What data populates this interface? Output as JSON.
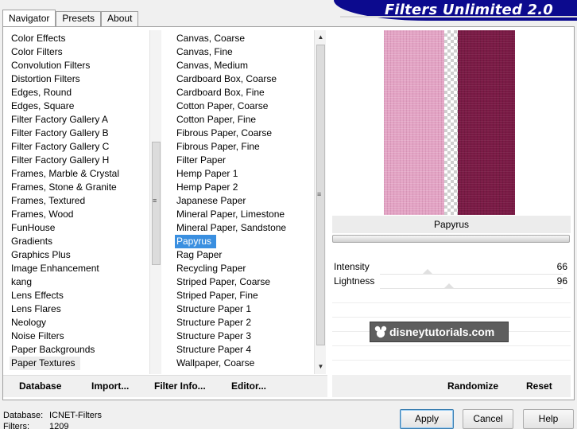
{
  "tabs": [
    {
      "label": "Navigator",
      "active": true
    },
    {
      "label": "Presets",
      "active": false
    },
    {
      "label": "About",
      "active": false
    }
  ],
  "title": "Filters Unlimited 2.0",
  "categories": {
    "items": [
      "Color Effects",
      "Color Filters",
      "Convolution Filters",
      "Distortion Filters",
      "Edges, Round",
      "Edges, Square",
      "Filter Factory Gallery A",
      "Filter Factory Gallery B",
      "Filter Factory Gallery C",
      "Filter Factory Gallery H",
      "Frames, Marble & Crystal",
      "Frames, Stone & Granite",
      "Frames, Textured",
      "Frames, Wood",
      "FunHouse",
      "Gradients",
      "Graphics Plus",
      "Image Enhancement",
      "kang",
      "Lens Effects",
      "Lens Flares",
      "Neology",
      "Noise Filters",
      "Paper Backgrounds",
      "Paper Textures"
    ],
    "selected": "Paper Textures"
  },
  "filters": {
    "items": [
      "Canvas, Coarse",
      "Canvas, Fine",
      "Canvas, Medium",
      "Cardboard Box, Coarse",
      "Cardboard Box, Fine",
      "Cotton Paper, Coarse",
      "Cotton Paper, Fine",
      "Fibrous Paper, Coarse",
      "Fibrous Paper, Fine",
      "Filter Paper",
      "Hemp Paper 1",
      "Hemp Paper 2",
      "Japanese Paper",
      "Mineral Paper, Limestone",
      "Mineral Paper, Sandstone",
      "Papyrus",
      "Rag Paper",
      "Recycling Paper",
      "Striped Paper, Coarse",
      "Striped Paper, Fine",
      "Structure Paper 1",
      "Structure Paper 2",
      "Structure Paper 3",
      "Structure Paper 4",
      "Wallpaper, Coarse"
    ],
    "selected": "Papyrus"
  },
  "buttons": {
    "database": "Database",
    "import": "Import...",
    "filter_info": "Filter Info...",
    "editor": "Editor...",
    "randomize": "Randomize",
    "reset": "Reset",
    "apply": "Apply",
    "cancel": "Cancel",
    "help": "Help"
  },
  "preview": {
    "filter_name": "Papyrus",
    "colors": {
      "left": "#e3a3c4",
      "right": "#7a1a45"
    }
  },
  "params": [
    {
      "label": "Intensity",
      "value": "66",
      "level": 0.26
    },
    {
      "label": "Lightness",
      "value": "96",
      "level": 0.38
    }
  ],
  "watermark": "disneytutorials.com",
  "status": {
    "database_label": "Database:",
    "database_value": "ICNET-Filters",
    "filters_label": "Filters:",
    "filters_value": "1209"
  },
  "colors": {
    "selection": "#3a8fe0",
    "banner": "#0c0a8e"
  }
}
